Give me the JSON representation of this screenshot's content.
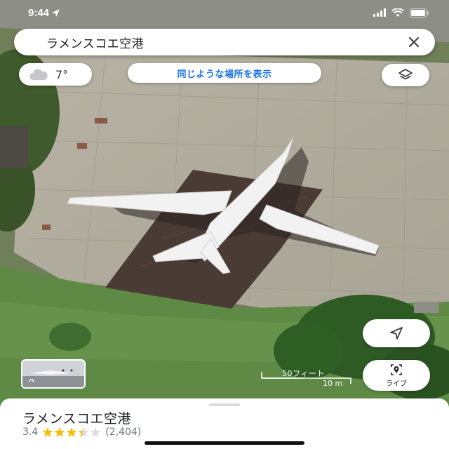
{
  "status_bar": {
    "time": "9:44"
  },
  "search": {
    "query": "ラメンスコエ空港"
  },
  "weather": {
    "temperature": "7°",
    "icon": "cloud-icon"
  },
  "chips": {
    "similar_places": "同じような場所を表示"
  },
  "scale": {
    "feet": "50フィート",
    "meters": "10 m"
  },
  "live_view": {
    "label": "ライブ"
  },
  "place": {
    "name": "ラメンスコエ空港",
    "rating": "3.4",
    "stars": 3.4,
    "reviews": "(2,404)"
  },
  "colors": {
    "accent": "#1a73e8",
    "star": "#fbbc04",
    "star_empty": "#dadce0"
  }
}
